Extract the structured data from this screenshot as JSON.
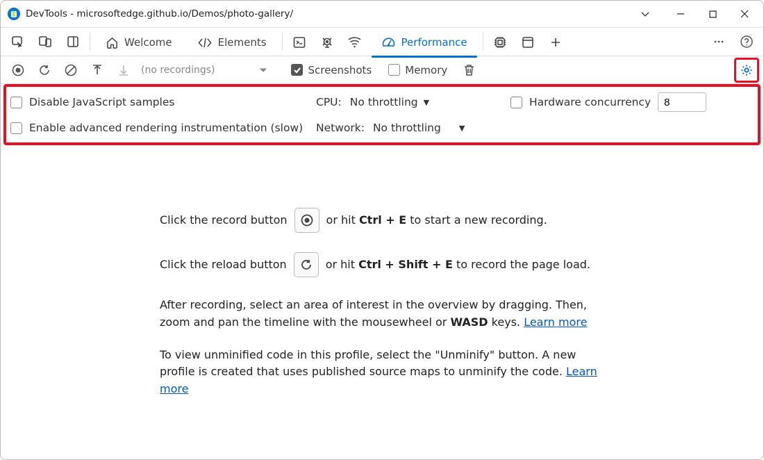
{
  "titlebar": {
    "title": "DevTools - microsoftedge.github.io/Demos/photo-gallery/"
  },
  "tabs": {
    "welcome": "Welcome",
    "elements": "Elements",
    "performance": "Performance"
  },
  "toolbar": {
    "no_recordings": "(no recordings)",
    "screenshots": "Screenshots",
    "memory": "Memory"
  },
  "settings": {
    "disable_js": "Disable JavaScript samples",
    "adv_rendering": "Enable advanced rendering instrumentation (slow)",
    "cpu_label": "CPU:",
    "cpu_value": "No throttling",
    "net_label": "Network:",
    "net_value": "No throttling",
    "hw_label": "Hardware concurrency",
    "hw_value": "8"
  },
  "hints": {
    "row1_a": "Click the record button",
    "row1_b": "or hit ",
    "row1_shortcut": "Ctrl + E",
    "row1_c": " to start a new recording.",
    "row2_a": "Click the reload button",
    "row2_b": "or hit ",
    "row2_shortcut": "Ctrl + Shift + E",
    "row2_c": " to record the page load.",
    "p1_a": "After recording, select an area of interest in the overview by dragging. Then, zoom and pan the timeline with the mousewheel or ",
    "p1_wasd": "WASD",
    "p1_b": " keys. ",
    "learn_more": "Learn more",
    "p2_a": "To view unminified code in this profile, select the \"Unminify\" button. A new profile is created that uses published source maps to unminify the code. "
  }
}
